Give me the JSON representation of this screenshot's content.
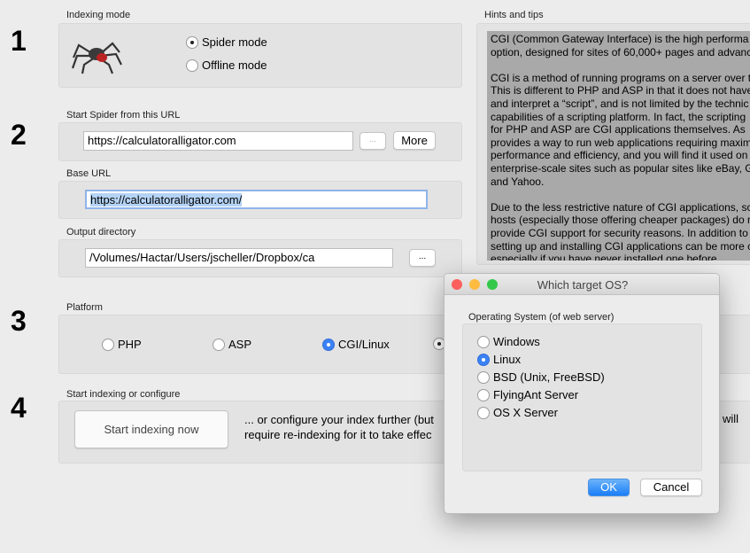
{
  "steps": [
    "1",
    "2",
    "3",
    "4"
  ],
  "indexing_mode": {
    "label": "Indexing mode",
    "options": [
      {
        "label": "Spider mode",
        "selected": true
      },
      {
        "label": "Offline mode",
        "selected": false
      }
    ]
  },
  "start_url": {
    "label": "Start Spider from this URL",
    "value": "https://calculatoralligator.com",
    "browse": "...",
    "more": "More"
  },
  "base_url": {
    "label": "Base URL",
    "value": "https://calculatoralligator.com/"
  },
  "output_dir": {
    "label": "Output directory",
    "value": "/Volumes/Hactar/Users/jscheller/Dropbox/ca",
    "browse": "..."
  },
  "platform": {
    "label": "Platform",
    "options": [
      {
        "label": "PHP",
        "selected": false
      },
      {
        "label": "ASP",
        "selected": false
      },
      {
        "label": "CGI/Linux",
        "selected": true
      }
    ]
  },
  "start": {
    "label": "Start indexing or configure",
    "button": "Start indexing now",
    "text1": "... or configure your index further (but",
    "text2": "require re-indexing for it to take effec",
    "text_end": "will"
  },
  "hints": {
    "label": "Hints and tips",
    "text": "CGI (Common Gateway Interface) is the high performa\noption, designed for sites of 60,000+ pages and advanc\n\nCGI is a method of running programs on a server over t\nThis is different to PHP and ASP in that it does not have\nand interpret a “script”, and is not limited by the technic\ncapabilities of a scripting platform. In fact, the scripting\nfor PHP and ASP are CGI applications themselves. As\nprovides a way to run web applications requiring maxim\nperformance and efficiency, and you will find it used on\nenterprise-scale sites such as popular sites like eBay, G\nand Yahoo.\n\nDue to the less restrictive nature of CGI applications, so\nhosts (especially those offering cheaper packages) do n\nprovide CGI support for security reasons. In addition to\nsetting up and installing CGI applications can be more c\nespecially if you have never installed one before."
  },
  "dialog": {
    "title": "Which target OS?",
    "group_label": "Operating System (of web server)",
    "options": [
      {
        "label": "Windows",
        "selected": false
      },
      {
        "label": "Linux",
        "selected": true
      },
      {
        "label": "BSD (Unix, FreeBSD)",
        "selected": false
      },
      {
        "label": "FlyingAnt Server",
        "selected": false
      },
      {
        "label": "OS X Server",
        "selected": false
      }
    ],
    "ok": "OK",
    "cancel": "Cancel"
  },
  "colors": {
    "accent": "#3b82f6",
    "close": "#fc605c",
    "minimize": "#fdbc40",
    "zoom": "#34c84a"
  }
}
